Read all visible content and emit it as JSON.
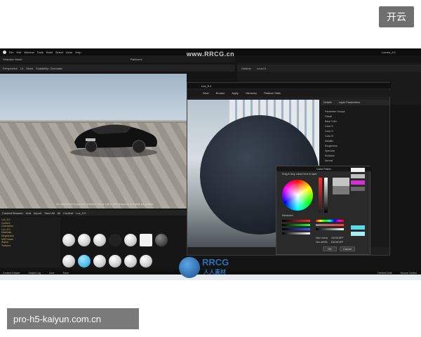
{
  "top_button": {
    "label": "开云"
  },
  "editor": {
    "menu": [
      "File",
      "Edit",
      "Window",
      "Tools",
      "Build",
      "Select",
      "Actor",
      "Help"
    ],
    "project_tab": "Lumen_5.1",
    "toolbar": [
      "Selection Mode",
      "Platforms"
    ],
    "viewport_bar": [
      "Perspective",
      "Lit",
      "Show",
      "Scalability: Cinematic"
    ],
    "viewport_message": "No active Level Sequencer detected. Please edit a Level Sequence to enable full controls",
    "outliner_tabs": [
      "Outliner",
      "Level 0"
    ],
    "content_browser": {
      "title": "Content Browser",
      "actions": [
        "Add",
        "Import",
        "Save All"
      ],
      "path": [
        "All",
        "Content",
        "Lux_5.0"
      ],
      "tree": [
        "Lux_5.0",
        "Content",
        "Characters",
        "Lux_5.0",
        "Materials",
        "Megascans",
        "MSPresets",
        "Starter",
        "Textures"
      ]
    },
    "status_items": [
      "Content Drawer",
      "Output Log",
      "Cmd",
      "Trace",
      "Derived Data",
      "Source Control"
    ]
  },
  "material_editor": {
    "title": "Lux_5.1",
    "toolbar": [
      "Save",
      "Browse",
      "Apply",
      "Hierarchy",
      "Platform Stats"
    ],
    "details_tabs": [
      "Details",
      "Layer Parameters"
    ],
    "details_rows": [
      "Parameter Groups",
      "Global",
      "Base Color",
      "Color R",
      "Color G",
      "Color B",
      "Metallic",
      "Roughness",
      "Specular",
      "Emissive",
      "Normal"
    ]
  },
  "color_picker": {
    "title": "Color Picker",
    "hint": "Drag & drop colors here to save",
    "labels": [
      "Advanced",
      "Hex Linear",
      "Hex sRGB"
    ],
    "hex_linear": "C6C6C6FF",
    "hex_srgb": "E4E4E4FF",
    "ok_label": "OK",
    "cancel_label": "Cancel",
    "colors": {
      "selected": "#c4c4c4",
      "previous": "#7a7a7a"
    }
  },
  "watermarks": {
    "top": "www.RRCG.cn",
    "logo": "RRCG",
    "logo_sub": "人人素材"
  },
  "bottom_label": {
    "text": "pro-h5-kaiyun.com.cn"
  }
}
